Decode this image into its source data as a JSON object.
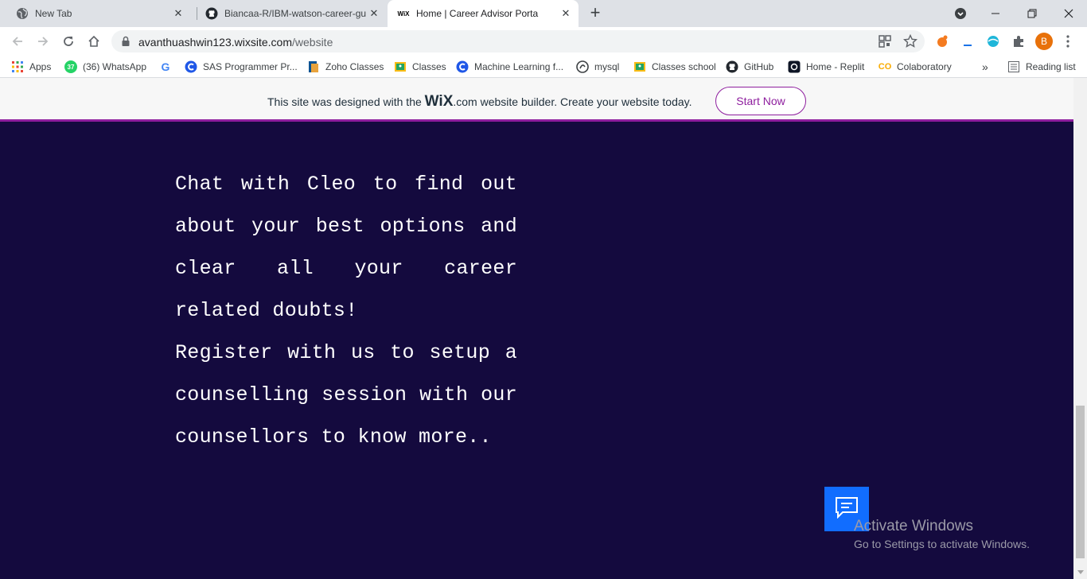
{
  "tabs": [
    {
      "title": "New Tab",
      "icon": "globe-icon",
      "active": false
    },
    {
      "title": "Biancaa-R/IBM-watson-career-gu",
      "icon": "github-icon",
      "active": false
    },
    {
      "title": "Home | Career Advisor Porta",
      "icon": "wix-icon",
      "favicon_text": "WiX",
      "active": true
    }
  ],
  "address_bar": {
    "domain": "avanthuashwin123.wixsite.com",
    "path": "/website"
  },
  "profile_initial": "B",
  "bookmarks": [
    {
      "label": "Apps",
      "icon": "apps-grid-icon"
    },
    {
      "label": "(36) WhatsApp",
      "icon": "whatsapp-icon",
      "badge": "37"
    },
    {
      "label": "",
      "icon": "google-icon",
      "icon_text": "G"
    },
    {
      "label": "SAS Programmer Pr...",
      "icon": "c-logo-icon"
    },
    {
      "label": "Zoho Classes",
      "icon": "zoho-icon"
    },
    {
      "label": "Classes",
      "icon": "google-classroom-icon"
    },
    {
      "label": "Machine Learning f...",
      "icon": "c-logo-icon"
    },
    {
      "label": "mysql",
      "icon": "mysql-icon"
    },
    {
      "label": "Classes school",
      "icon": "google-classroom-icon"
    },
    {
      "label": "GitHub",
      "icon": "github-icon"
    },
    {
      "label": "Home - Replit",
      "icon": "replit-icon"
    },
    {
      "label": "Colaboratory",
      "icon": "colab-icon",
      "icon_text": "CO"
    }
  ],
  "reading_list": "Reading list",
  "wix_banner": {
    "text_before": "This site was designed with the ",
    "brand": "WiX",
    "text_after": ".com website builder. Create your website today.",
    "button": "Start Now"
  },
  "content": {
    "paragraph1": "Chat with Cleo to find out about your best options and clear all your career related doubts!",
    "paragraph2": "Register with us to setup a counselling session with our counsellors to know more.."
  },
  "watermark": {
    "title": "Activate Windows",
    "subtitle": "Go to Settings to activate Windows."
  },
  "colors": {
    "page_background": "#140a3e",
    "wix_accent": "#8e1e9e",
    "chat_button": "#116dff"
  }
}
